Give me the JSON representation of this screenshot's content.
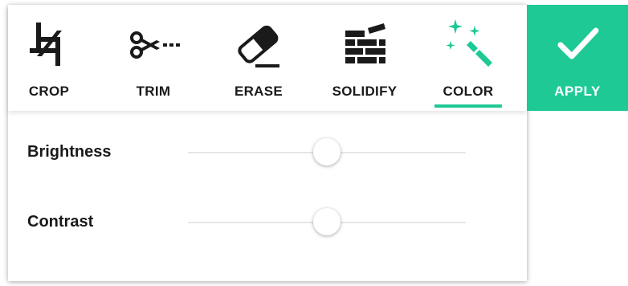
{
  "toolbar": {
    "tools": [
      {
        "label": "CROP",
        "icon": "crop-icon",
        "active": false
      },
      {
        "label": "TRIM",
        "icon": "scissors-icon",
        "active": false
      },
      {
        "label": "ERASE",
        "icon": "eraser-icon",
        "active": false
      },
      {
        "label": "SOLIDIFY",
        "icon": "bricks-icon",
        "active": false
      },
      {
        "label": "COLOR",
        "icon": "magic-wand-icon",
        "active": true
      }
    ],
    "apply_label": "APPLY",
    "apply_icon": "checkmark-icon"
  },
  "sliders": [
    {
      "label": "Brightness",
      "value_fraction": 0.5
    },
    {
      "label": "Contrast",
      "value_fraction": 0.5
    }
  ],
  "colors": {
    "accent": "#1ec996",
    "icon": "#1a1a1a",
    "text": "#1a1a1a",
    "track": "#e6e6e6"
  }
}
